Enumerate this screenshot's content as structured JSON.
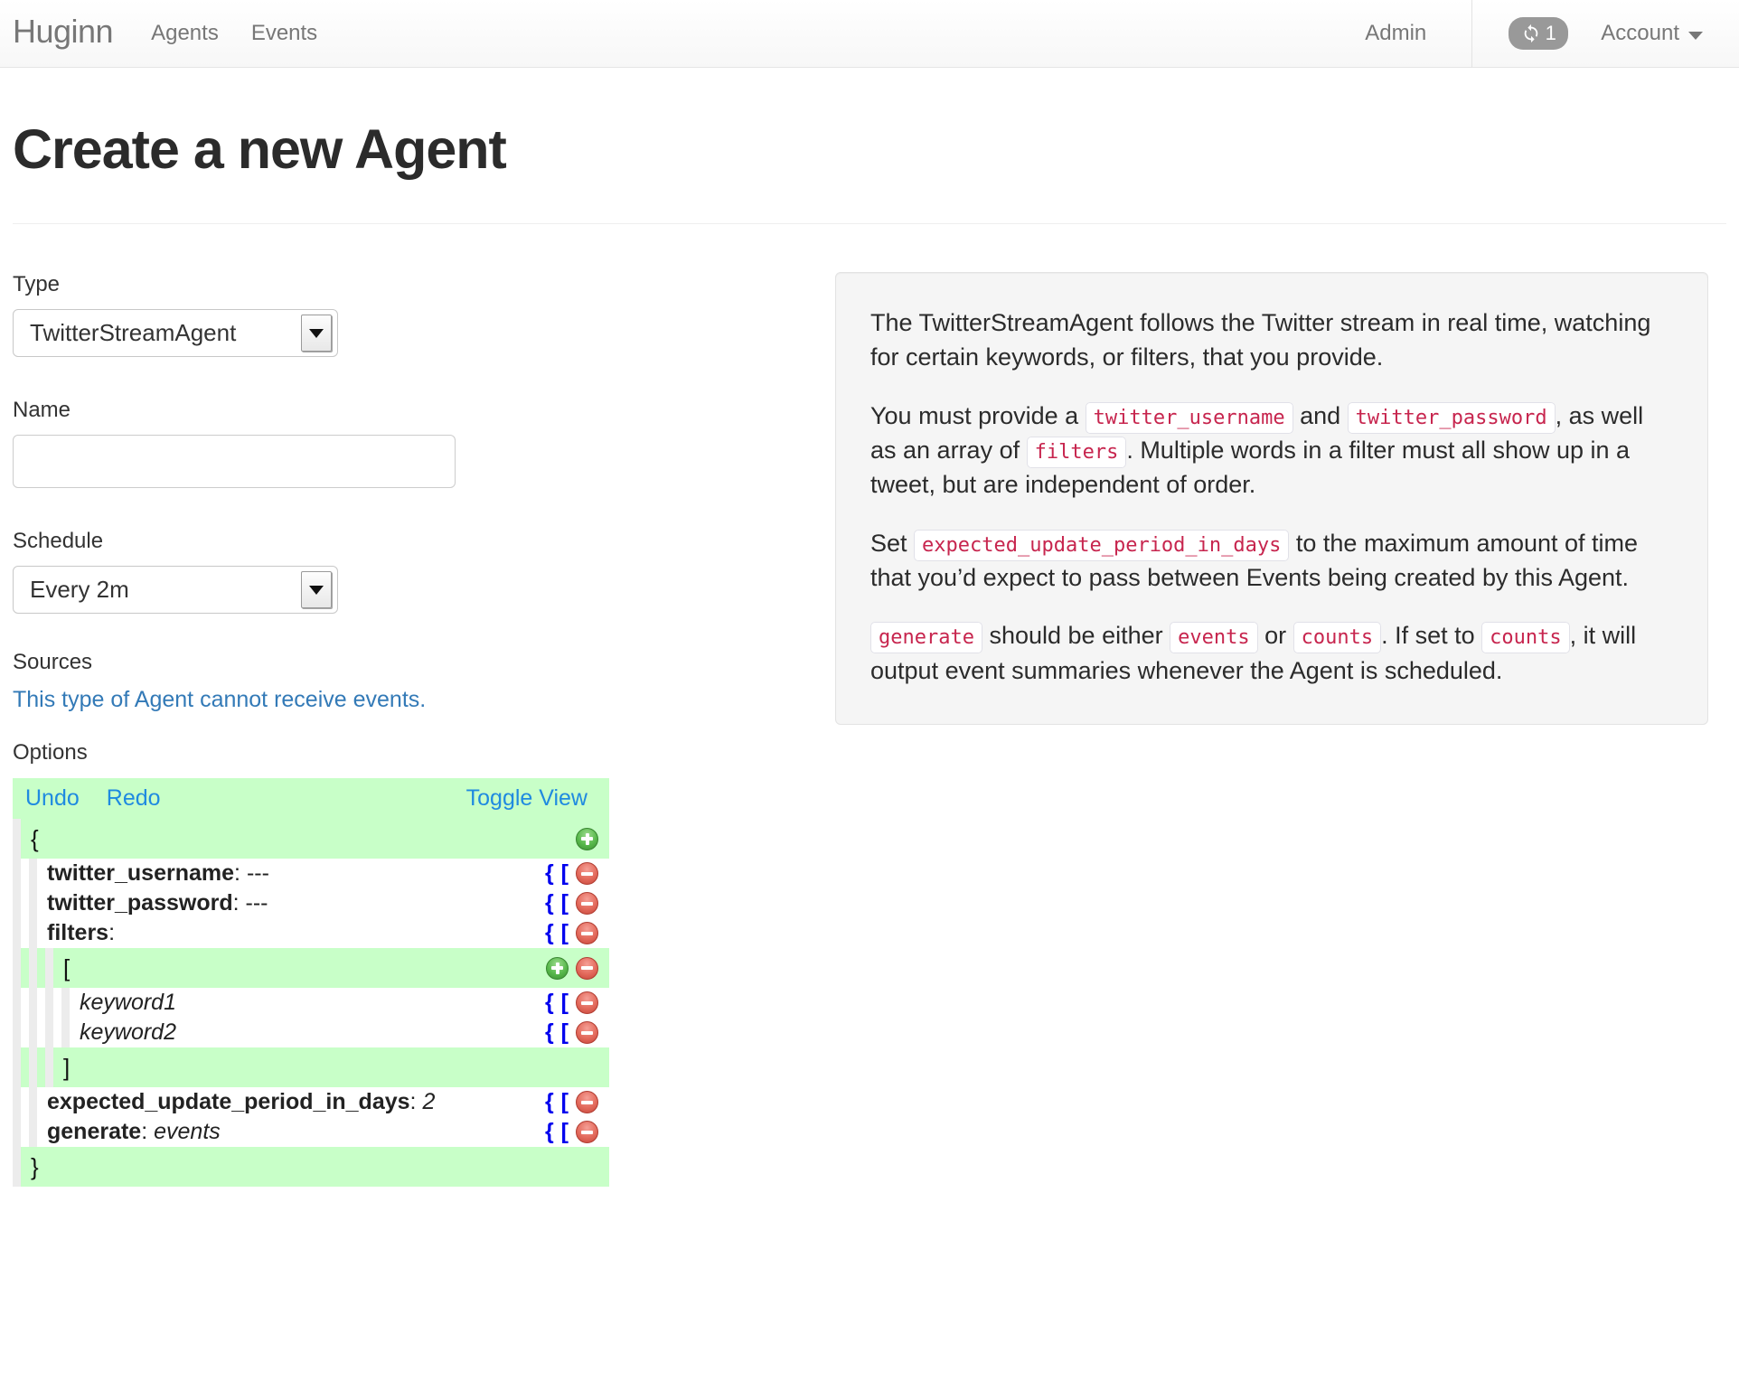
{
  "navbar": {
    "brand": "Huginn",
    "links": [
      {
        "label": "Agents",
        "name": "nav-link-agents"
      },
      {
        "label": "Events",
        "name": "nav-link-events"
      }
    ],
    "admin_label": "Admin",
    "badge": {
      "count": "1",
      "icon": "sync-refresh-icon"
    },
    "account_label": "Account"
  },
  "page": {
    "title": "Create a new Agent"
  },
  "form": {
    "type": {
      "label": "Type",
      "value": "TwitterStreamAgent",
      "options": [
        "TwitterStreamAgent"
      ]
    },
    "name": {
      "label": "Name",
      "value": "",
      "placeholder": ""
    },
    "schedule": {
      "label": "Schedule",
      "value": "Every 2m",
      "options": [
        "Every 2m"
      ]
    },
    "sources": {
      "label": "Sources",
      "note": "This type of Agent cannot receive events."
    },
    "options": {
      "label": "Options"
    }
  },
  "editor": {
    "undo_label": "Undo",
    "redo_label": "Redo",
    "toggle_view_label": "Toggle View",
    "brace_button": "{",
    "bracket_button": "[",
    "rows": [
      {
        "text": "{",
        "value": ""
      },
      {
        "text": "twitter_username",
        "value": "---"
      },
      {
        "text": "twitter_password",
        "value": "---"
      },
      {
        "text": "filters",
        "value": ""
      },
      {
        "text": "[",
        "value": ""
      },
      {
        "text": "keyword1",
        "value": ""
      },
      {
        "text": "keyword2",
        "value": ""
      },
      {
        "text": "]",
        "value": ""
      },
      {
        "text": "expected_update_period_in_days",
        "value": "2"
      },
      {
        "text": "generate",
        "value": "events"
      },
      {
        "text": "}",
        "value": ""
      }
    ]
  },
  "description": {
    "p1_a": "The TwitterStreamAgent follows the Twitter stream in real time, watching for certain keywords, or filters, that you provide.",
    "p2_a": "You must provide a ",
    "p2_code1": "twitter_username",
    "p2_b": " and ",
    "p2_code2": "twitter_password",
    "p2_c": ", as well as an array of ",
    "p2_code3": "filters",
    "p2_d": ". Multiple words in a filter must all show up in a tweet, but are independent of order.",
    "p3_a": "Set ",
    "p3_code1": "expected_update_period_in_days",
    "p3_b": " to the maximum amount of time that you’d expect to pass between Events being created by this Agent.",
    "p4_code1": "generate",
    "p4_a": " should be either ",
    "p4_code2": "events",
    "p4_b": " or ",
    "p4_code3": "counts",
    "p4_c": ". If set to ",
    "p4_code4": "counts",
    "p4_d": ", it will output event summaries whenever the Agent is scheduled."
  },
  "colors": {
    "editor_highlight": "#c8ffc8",
    "link": "#337ab7",
    "code_text": "#c7254e",
    "badge_bg": "#999999"
  }
}
